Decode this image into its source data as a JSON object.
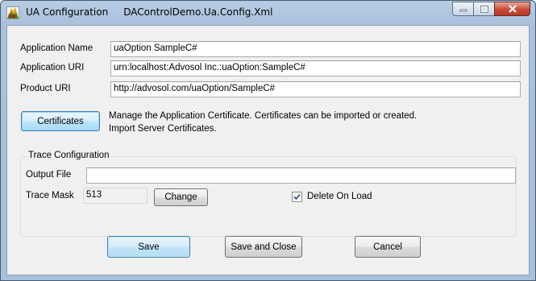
{
  "window": {
    "title": "UA Configuration     DAControlDemo.Ua.Config.Xml",
    "icon": "ua-app-icon",
    "controls": {
      "minimize": "minimize-icon",
      "maximize": "maximize-icon",
      "close": "close-icon"
    }
  },
  "form": {
    "app_name_label": "Application Name",
    "app_name_value": "uaOption SampleC#",
    "app_uri_label": "Application URI",
    "app_uri_value": "urn:localhost:Advosol Inc.:uaOption:SampleC#",
    "product_uri_label": "Product URI",
    "product_uri_value": "http://advosol.com/uaOption/SampleC#"
  },
  "certificates": {
    "button_label": "Certificates",
    "description_line1": "Manage the Application Certificate.  Certificates can be imported or created.",
    "description_line2": "Import Server Certificates."
  },
  "trace": {
    "group_title": "Trace Configuration",
    "output_file_label": "Output File",
    "output_file_value": "",
    "trace_mask_label": "Trace Mask",
    "trace_mask_value": "513",
    "change_label": "Change",
    "delete_on_load_label": "Delete On Load",
    "delete_on_load_checked": true
  },
  "actions": {
    "save": "Save",
    "save_and_close": "Save and Close",
    "cancel": "Cancel"
  },
  "colors": {
    "title_bar": "#a9c1dc",
    "client_background": "#f0f0f0",
    "close_button": "#c94a36"
  }
}
